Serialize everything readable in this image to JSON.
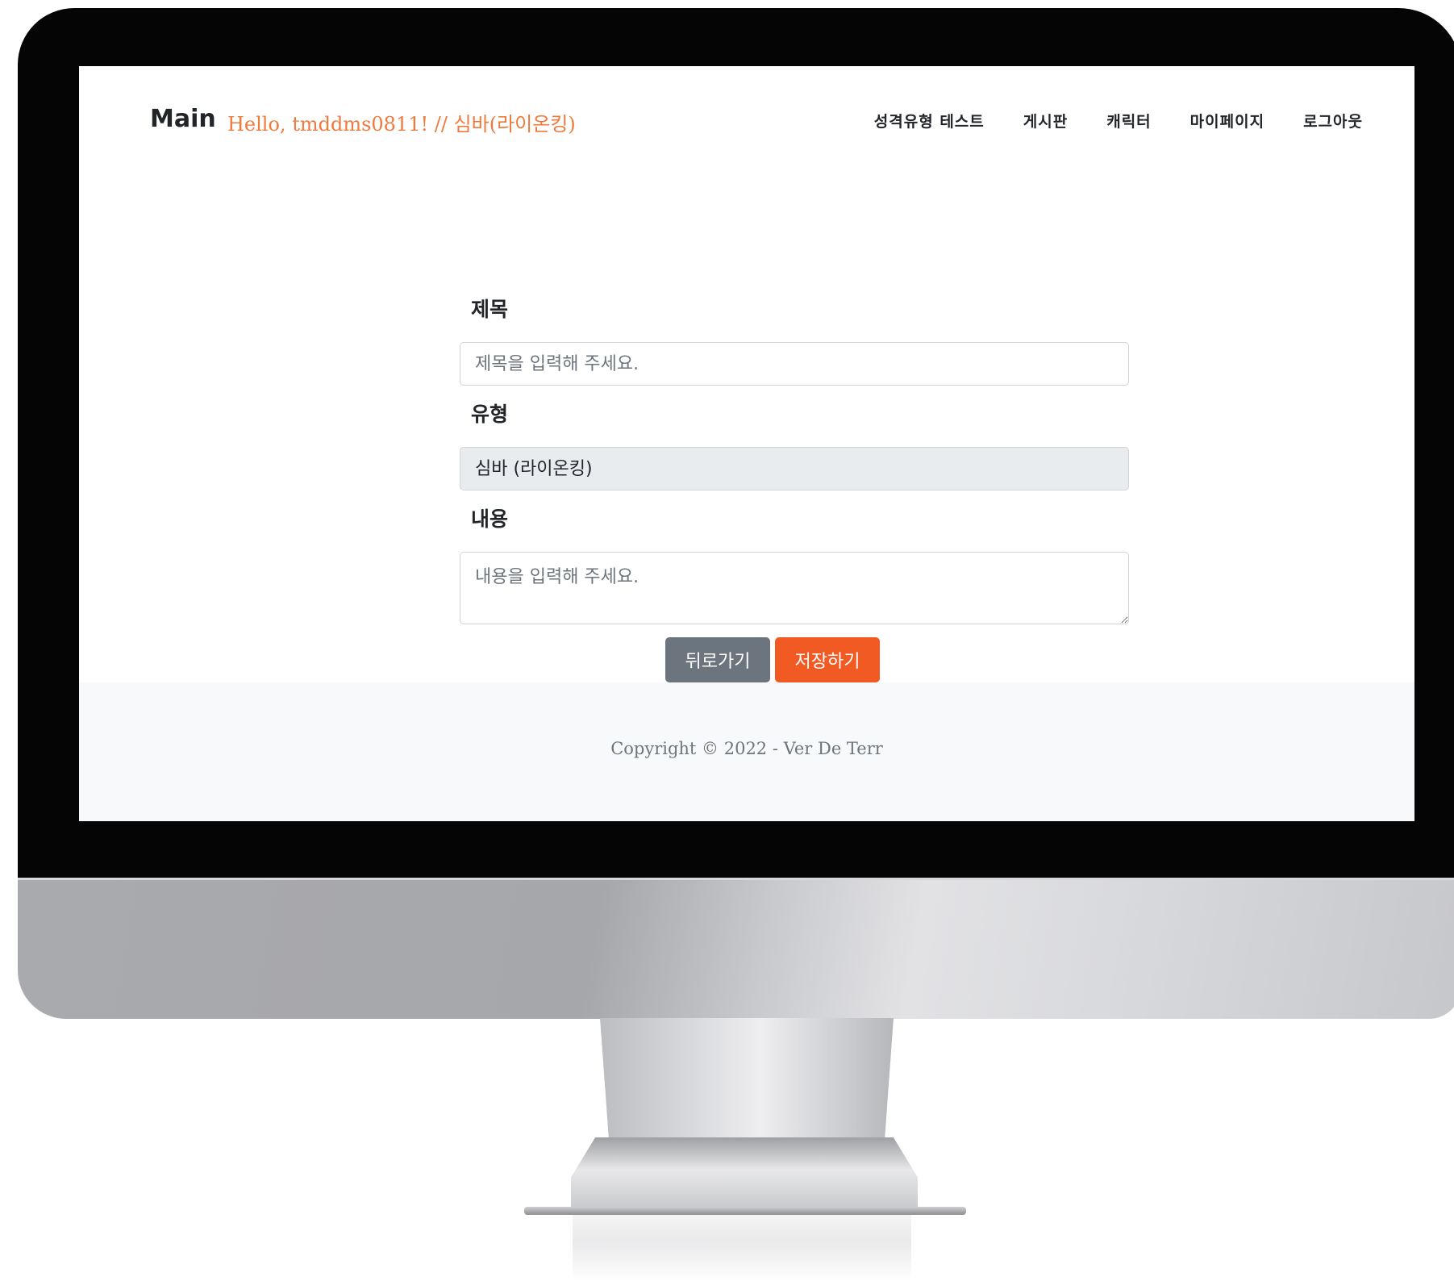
{
  "navbar": {
    "brand": "Main",
    "greeting": "Hello, tmddms0811! // 심바(라이온킹)",
    "menu": [
      "성격유형 테스트",
      "게시판",
      "캐릭터",
      "마이페이지",
      "로그아웃"
    ]
  },
  "form": {
    "title_label": "제목",
    "title_placeholder": "제목을 입력해 주세요.",
    "type_label": "유형",
    "type_value": "심바 (라이온킹)",
    "content_label": "내용",
    "content_placeholder": "내용을 입력해 주세요."
  },
  "buttons": {
    "back": "뒤로가기",
    "save": "저장하기"
  },
  "footer": {
    "copyright": "Copyright © 2022 - Ver De Terr"
  },
  "colors": {
    "accent": "#f25a23",
    "greeting": "#f07a3c",
    "secondary_button": "#6c757d",
    "footer_bg": "#f8f9fa"
  }
}
